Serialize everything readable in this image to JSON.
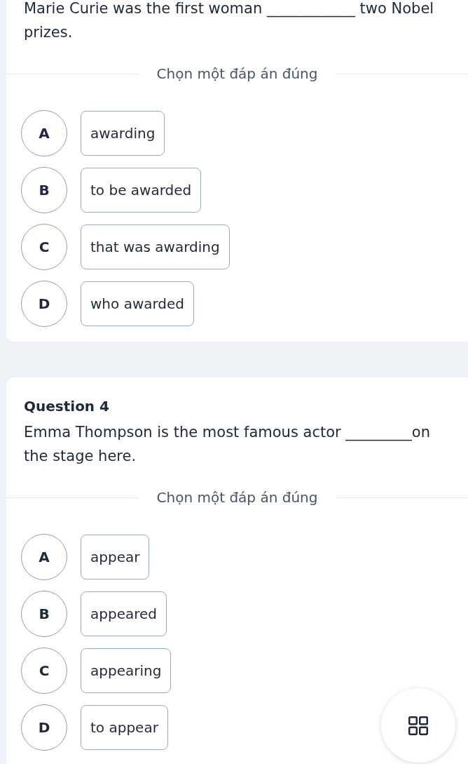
{
  "questions": [
    {
      "sentence": "Marie Curie was the first woman ____________ two Nobel prizes.",
      "instruction": "Chọn một đáp án đúng",
      "options": [
        {
          "letter": "A",
          "text": "awarding",
          "selected": false
        },
        {
          "letter": "B",
          "text": "to be awarded",
          "selected": false
        },
        {
          "letter": "C",
          "text": "that was awarding",
          "selected": false
        },
        {
          "letter": "D",
          "text": "who awarded",
          "selected": false
        }
      ]
    },
    {
      "title": "Question 4",
      "sentence": "Emma Thompson is the most famous actor _________on the stage here.",
      "instruction": "Chọn một đáp án đúng",
      "options": [
        {
          "letter": "A",
          "text": "appear",
          "selected": false
        },
        {
          "letter": "B",
          "text": "appeared",
          "selected": false
        },
        {
          "letter": "C",
          "text": "appearing",
          "selected": false
        },
        {
          "letter": "D",
          "text": "to appear",
          "selected": false
        }
      ]
    }
  ]
}
